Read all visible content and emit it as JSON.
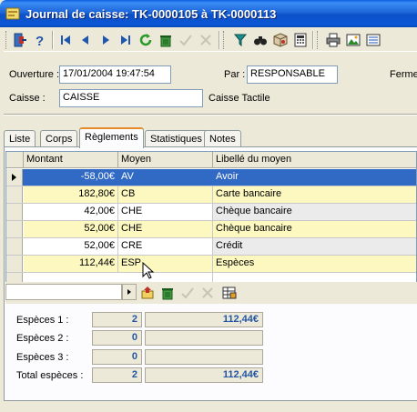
{
  "window": {
    "title": "Journal de caisse: TK-0000105 à TK-0000113"
  },
  "toolbar": {
    "icons": [
      "exit-icon",
      "help-icon",
      "first-icon",
      "prev-icon",
      "next-icon",
      "last-icon",
      "refresh-icon",
      "delete-icon",
      "validate-icon",
      "cancel-icon",
      "filter-icon",
      "search-icon",
      "package-icon",
      "calculator-icon",
      "print-icon",
      "image-icon",
      "export-icon"
    ]
  },
  "header": {
    "ouverture_label": "Ouverture :",
    "ouverture_value": "17/01/2004 19:47:54",
    "par_label": "Par :",
    "par_value": "RESPONSABLE",
    "ferme_label": "Ferme",
    "caisse_label": "Caisse :",
    "caisse_value": "CAISSE",
    "caisse_desc": "Caisse Tactile"
  },
  "tabs": [
    "Liste",
    "Corps",
    "Règlements",
    "Statistiques",
    "Notes"
  ],
  "active_tab": "Règlements",
  "grid": {
    "columns": [
      "Montant",
      "Moyen",
      "Libellé du moyen"
    ],
    "rows": [
      {
        "montant": "-58,00€",
        "moyen": "AV",
        "libelle": "Avoir",
        "selected": true
      },
      {
        "montant": "182,80€",
        "moyen": "CB",
        "libelle": "Carte bancaire"
      },
      {
        "montant": "42,00€",
        "moyen": "CHE",
        "libelle": "Chèque bancaire"
      },
      {
        "montant": "52,00€",
        "moyen": "CHE",
        "libelle": "Chèque bancaire"
      },
      {
        "montant": "52,00€",
        "moyen": "CRE",
        "libelle": "Crédit"
      },
      {
        "montant": "112,44€",
        "moyen": "ESP",
        "libelle": "Espèces"
      }
    ]
  },
  "stats": [
    {
      "label": "Espèces 1 :",
      "count": "2",
      "amount": "112,44€"
    },
    {
      "label": "Espèces 2 :",
      "count": "0",
      "amount": ""
    },
    {
      "label": "Espèces 3 :",
      "count": "0",
      "amount": ""
    },
    {
      "label": "Total espèces :",
      "count": "2",
      "amount": "112,44€"
    }
  ],
  "colors": {
    "title_bar": "#1d66d8",
    "selected_row": "#316ac5",
    "row_yellow": "#fcf8c0",
    "row_gray": "#ebebeb",
    "stat_value": "#2255a4"
  }
}
